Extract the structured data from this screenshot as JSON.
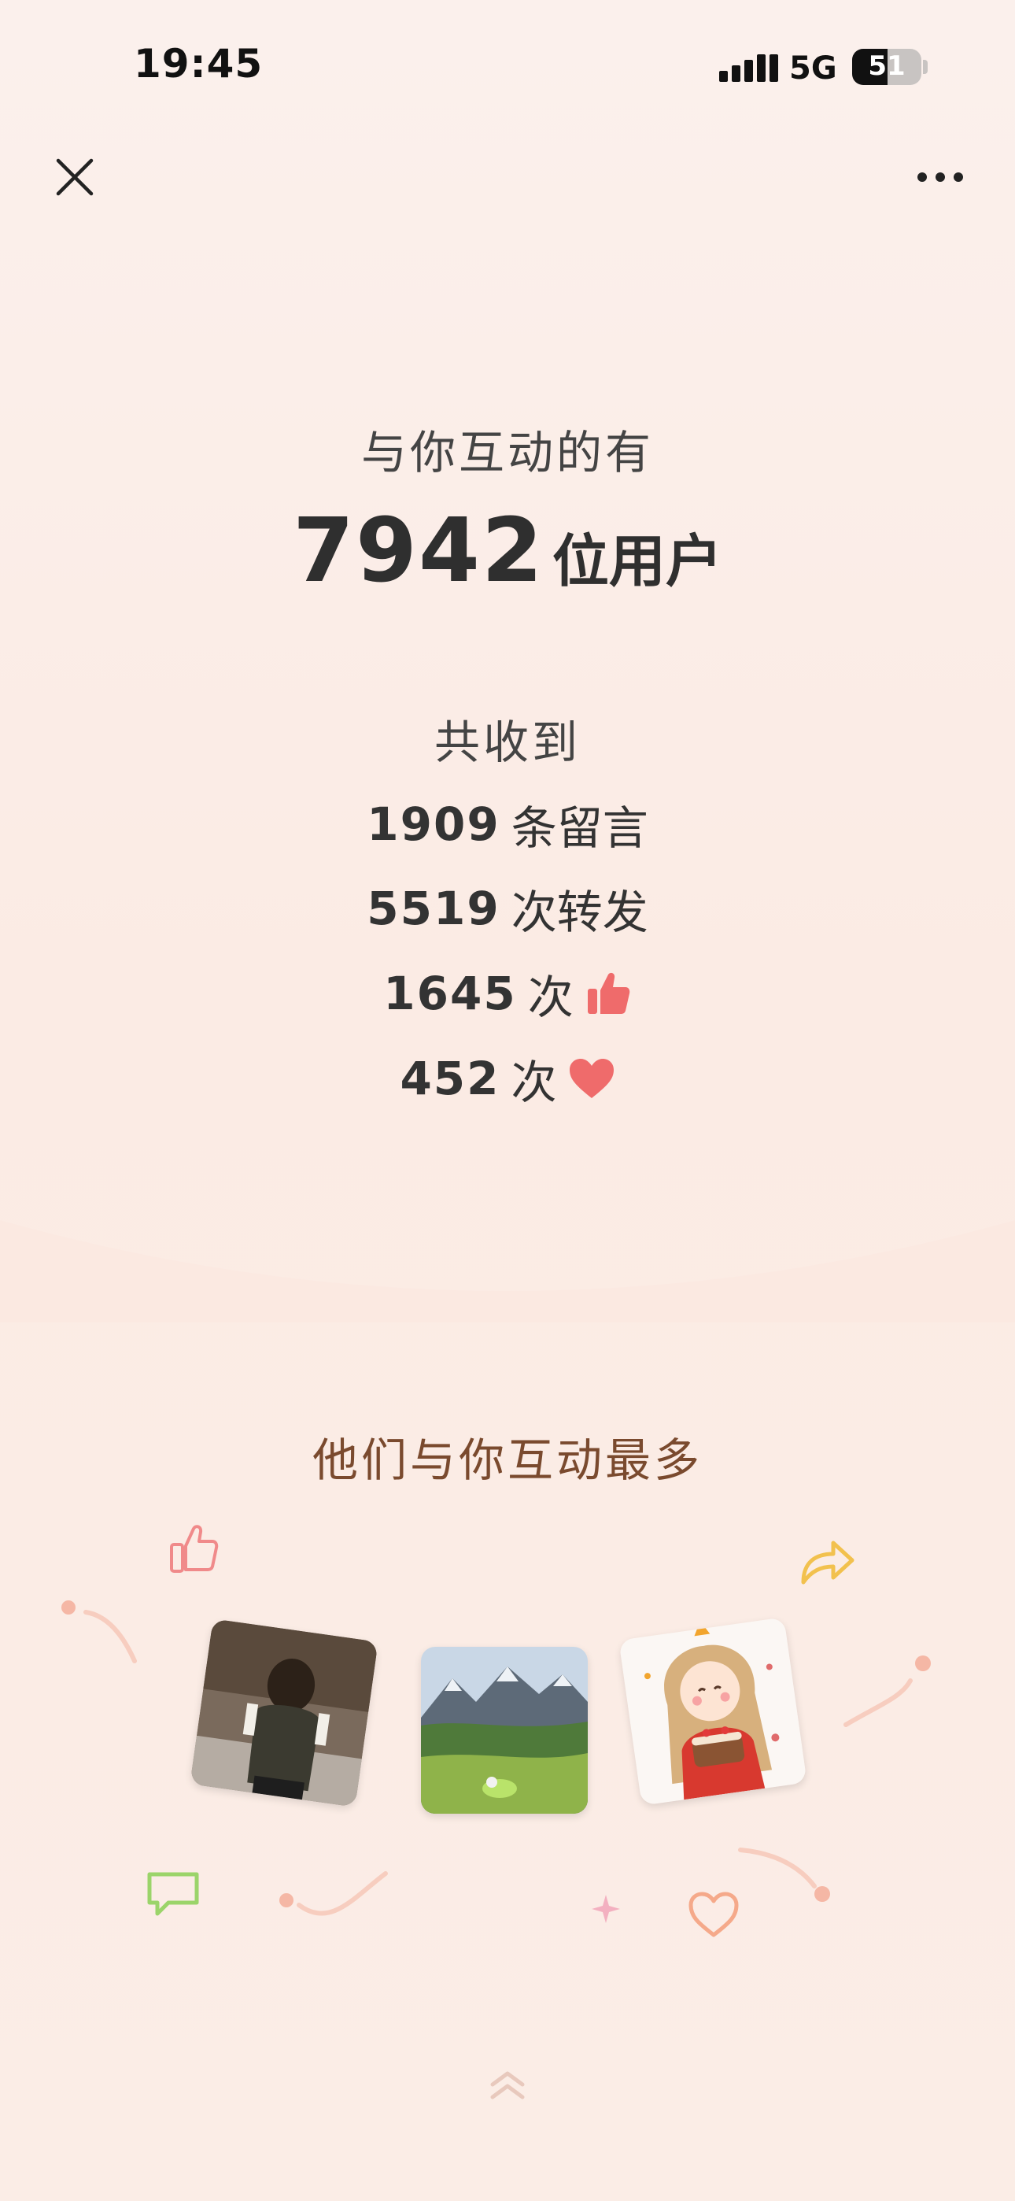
{
  "status_bar": {
    "time": "19:45",
    "network": "5G",
    "battery": "51",
    "battery_level": 0.51
  },
  "summary": {
    "heading": "与你互动的有",
    "user_count": "7942",
    "user_unit": "位用户",
    "received_label": "共收到",
    "stats": [
      {
        "count": "1909",
        "label": "条留言",
        "icon": ""
      },
      {
        "count": "5519",
        "label": "次转发",
        "icon": ""
      },
      {
        "count": "1645",
        "label": "次",
        "icon": "thumbs-up-icon"
      },
      {
        "count": "452",
        "label": "次",
        "icon": "heart-icon"
      }
    ]
  },
  "top_interactors": {
    "title": "他们与你互动最多",
    "avatars": [
      "person-photo",
      "mountain-landscape-photo",
      "birthday-girl-illustration"
    ]
  },
  "colors": {
    "accent_red": "#ef6b6b",
    "title_brown": "#7a4a2e",
    "text_dark": "#333333"
  }
}
